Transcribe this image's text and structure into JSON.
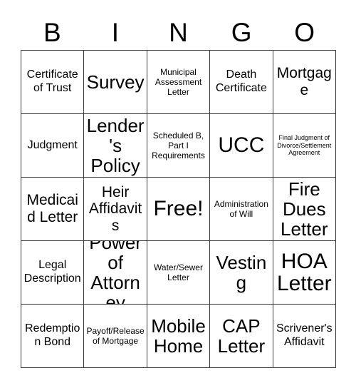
{
  "card": {
    "header_letters": [
      "B",
      "I",
      "N",
      "G",
      "O"
    ],
    "rows": [
      [
        {
          "label": "Certificate of Trust",
          "size": "md"
        },
        {
          "label": "Survey",
          "size": "xl"
        },
        {
          "label": "Municipal Assessment Letter",
          "size": "sm"
        },
        {
          "label": "Death Certificate",
          "size": "md"
        },
        {
          "label": "Mortgage",
          "size": "lg"
        }
      ],
      [
        {
          "label": "Judgment",
          "size": "md"
        },
        {
          "label": "Lender's Policy",
          "size": "xl"
        },
        {
          "label": "Scheduled B, Part I Requirements",
          "size": "sm"
        },
        {
          "label": "UCC",
          "size": "xxl"
        },
        {
          "label": "Final Judgment of Divorce/Settlement Agreement",
          "size": "xs"
        }
      ],
      [
        {
          "label": "Medicaid Letter",
          "size": "lg"
        },
        {
          "label": "Heir Affidavits",
          "size": "lg"
        },
        {
          "label": "Free!",
          "size": "xxl"
        },
        {
          "label": "Administration of Will",
          "size": "sm"
        },
        {
          "label": "Fire Dues Letter",
          "size": "xl"
        }
      ],
      [
        {
          "label": "Legal Description",
          "size": "md"
        },
        {
          "label": "Power of Attorney",
          "size": "xl"
        },
        {
          "label": "Water/Sewer Letter",
          "size": "sm"
        },
        {
          "label": "Vesting",
          "size": "xl"
        },
        {
          "label": "HOA Letter",
          "size": "xxl"
        }
      ],
      [
        {
          "label": "Redemption Bond",
          "size": "md"
        },
        {
          "label": "Payoff/Release of Mortgage",
          "size": "sm"
        },
        {
          "label": "Mobile Home",
          "size": "xl"
        },
        {
          "label": "CAP Letter",
          "size": "xl"
        },
        {
          "label": "Scrivener's Affidavit",
          "size": "md"
        }
      ]
    ]
  },
  "colors": {
    "background": "#ffffff",
    "text": "#000000",
    "border": "#3a3a3a"
  }
}
